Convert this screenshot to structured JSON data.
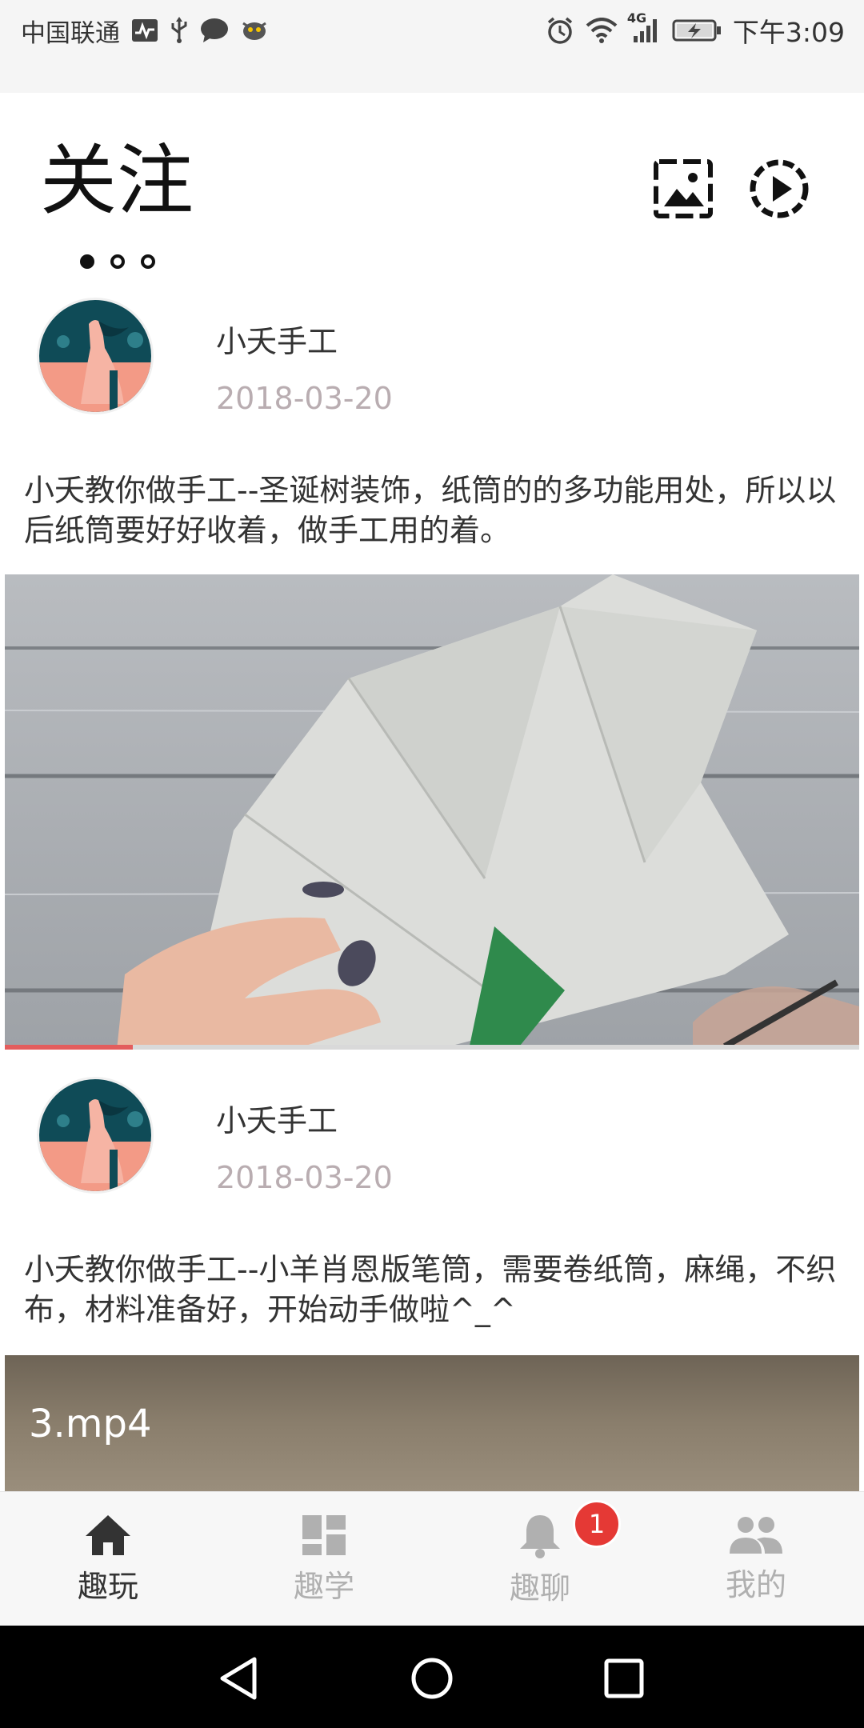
{
  "status_bar": {
    "carrier": "中国联通",
    "time": "下午3:09",
    "network": "4G"
  },
  "header": {
    "title": "关注"
  },
  "posts": [
    {
      "author": "小夭手工",
      "date": "2018-03-20",
      "description": "小夭教你做手工--圣诞树装饰，纸筒的的多功能用处，所以以后纸筒要好好收着，做手工用的着。",
      "progress_percent": 15
    },
    {
      "author": "小夭手工",
      "date": "2018-03-20",
      "description": "小夭教你做手工--小羊肖恩版笔筒，需要卷纸筒，麻绳，不织布，材料准备好，开始动手做啦^_^",
      "video_label": "3.mp4"
    }
  ],
  "bottom_nav": {
    "items": [
      {
        "label": "趣玩",
        "icon": "home-icon",
        "active": true
      },
      {
        "label": "趣学",
        "icon": "dashboard-icon",
        "active": false
      },
      {
        "label": "趣聊",
        "icon": "bell-icon",
        "active": false,
        "badge": "1"
      },
      {
        "label": "我的",
        "icon": "people-icon",
        "active": false
      }
    ]
  },
  "colors": {
    "active": "#333333",
    "inactive": "#b0b0b0",
    "badge": "#e53935",
    "progress": "#e35d5d"
  }
}
